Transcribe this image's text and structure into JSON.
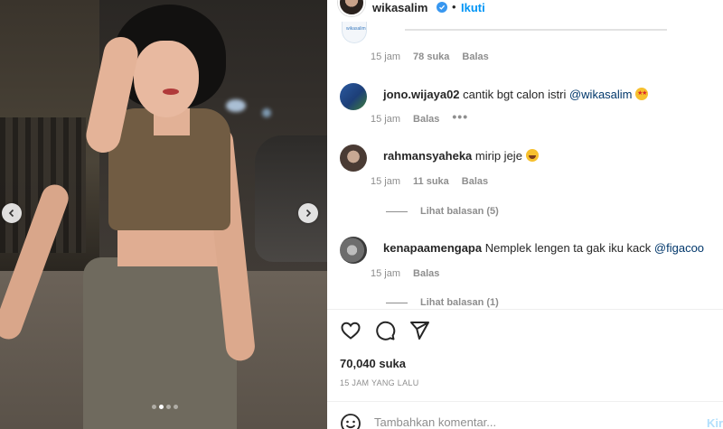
{
  "header": {
    "username": "wikasalim",
    "separator": "•",
    "follow_label": "Ikuti",
    "avatar_icon": "profile-avatar",
    "verified_icon": "verified-badge-icon"
  },
  "carousel": {
    "prev_icon": "chevron-left-icon",
    "next_icon": "chevron-right-icon",
    "slide_count": 4,
    "active_index": 1
  },
  "partial_comment": {
    "avatar_text": "wikasalim",
    "time": "15 jam",
    "likes": "78 suka",
    "reply_label": "Balas"
  },
  "comments": [
    {
      "username": "jono.wijaya02",
      "text": "cantik bgt calon istri",
      "mention": "@wikasalim",
      "emoji": "star-struck",
      "time": "15 jam",
      "likes": "",
      "reply_label": "Balas",
      "more": "•••"
    },
    {
      "username": "rahmansyaheka",
      "text": "mirip jeje",
      "emoji": "laughing",
      "time": "15 jam",
      "likes": "11 suka",
      "reply_label": "Balas",
      "replies": "Lihat balasan (5)"
    },
    {
      "username": "kenapaamengapa",
      "text": "Nemplek lengen ta gak iku kack",
      "mention": "@figacoo",
      "time": "15 jam",
      "reply_label": "Balas",
      "replies": "Lihat balasan (1)"
    }
  ],
  "actions": {
    "like_icon": "heart-icon",
    "comment_icon": "comment-icon",
    "share_icon": "share-icon"
  },
  "likes_count": "70,040 suka",
  "posted_time": "15 JAM YANG LALU",
  "add_comment": {
    "emoji_icon": "emoji-icon",
    "placeholder": "Tambahkan komentar...",
    "post_label": "Kirim"
  }
}
